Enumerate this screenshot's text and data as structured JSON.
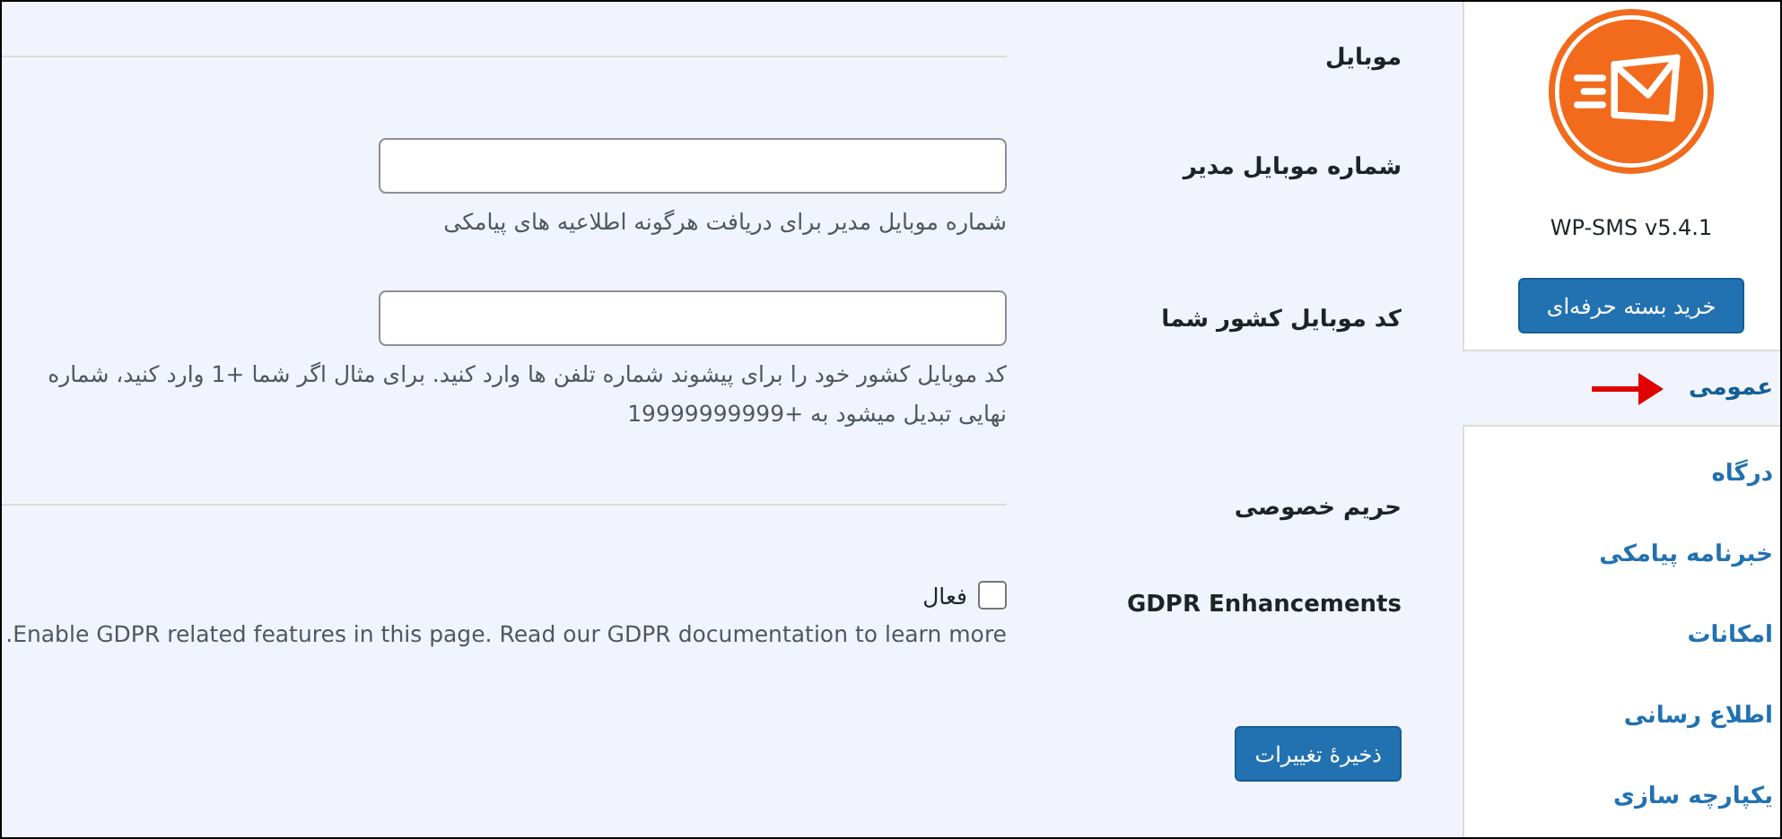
{
  "sidebar": {
    "version": "WP-SMS v5.4.1",
    "buy_button": "خرید بسته حرفه‌ای",
    "menu": [
      {
        "label": "عمومی",
        "selected": true
      },
      {
        "label": "درگاه",
        "selected": false
      },
      {
        "label": "خبرنامه پیامکی",
        "selected": false
      },
      {
        "label": "امکانات",
        "selected": false
      },
      {
        "label": "اطلاع رسانی",
        "selected": false
      },
      {
        "label": "یکپارچه سازی",
        "selected": false
      }
    ]
  },
  "sections": [
    {
      "heading": "موبایل",
      "fields": [
        {
          "kind": "text",
          "label": "شماره موبایل مدیر",
          "description": "شماره موبایل مدیر برای دریافت هرگونه اطلاعیه های پیامکی"
        },
        {
          "kind": "text",
          "label": "کد موبایل کشور شما",
          "description": "کد موبایل کشور خود را برای پیشوند شماره تلفن ها وارد کنید. برای مثال اگر شما +1 وارد کنید، شماره نهایی تبدیل میشود به +19999999999"
        }
      ]
    },
    {
      "heading": "حریم خصوصی",
      "fields": [
        {
          "kind": "checkbox",
          "label": "GDPR Enhancements",
          "option": "فعال",
          "checked": false,
          "description": "Enable GDPR related features in this page. Read our GDPR documentation to learn more."
        }
      ]
    }
  ],
  "save_button": "ذخیرهٔ تغییرات"
}
